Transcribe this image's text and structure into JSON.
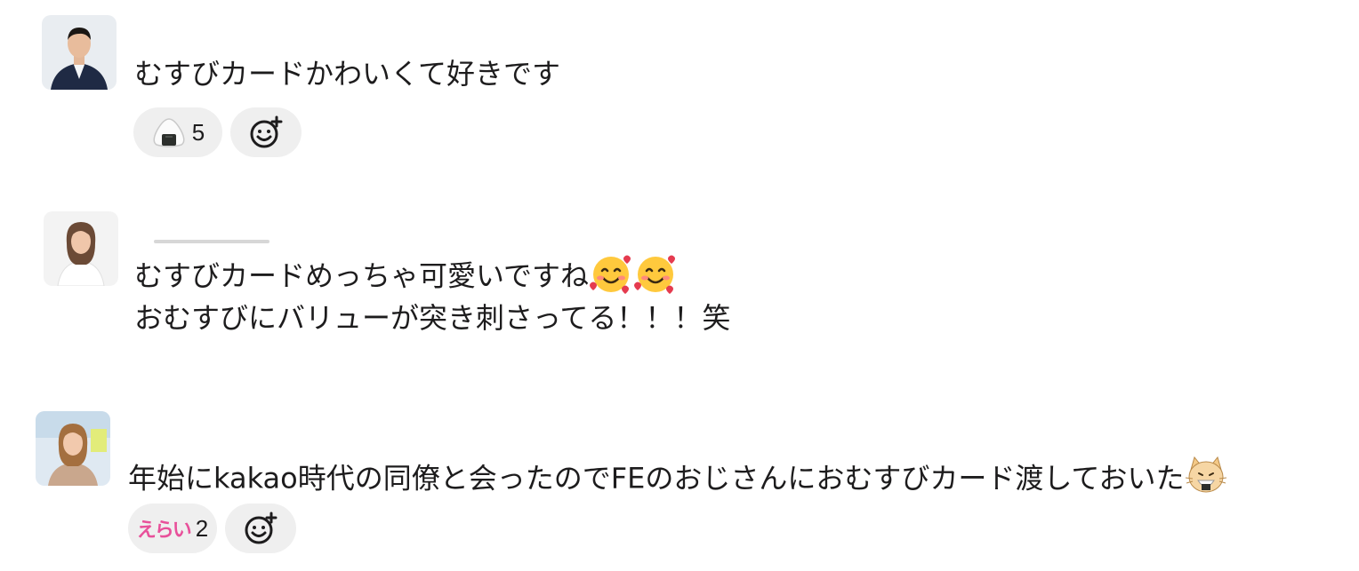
{
  "messages": [
    {
      "avatar": "avatar-man-navy-suit",
      "lines": [
        "むすびカードかわいくて好きです"
      ],
      "reactions": [
        {
          "emoji": "onigiri-icon",
          "count": "5"
        }
      ],
      "add_reaction": "add-reaction-icon"
    },
    {
      "avatar": "avatar-woman-white-blouse",
      "lines": [
        "むすびカードめっちゃ可愛いですね",
        "おむすびにバリューが突き刺さってる！！！笑"
      ],
      "inline_emojis": [
        "smiling-face-with-hearts-icon",
        "smiling-face-with-hearts-icon"
      ],
      "reactions": [],
      "add_reaction": ""
    },
    {
      "avatar": "avatar-woman-beige-top",
      "lines": [
        "年始にkakao時代の同僚と会ったのでFEのおじさんにおむすびカード渡しておいた"
      ],
      "inline_emojis": [
        "cat-eating-onigiri-icon"
      ],
      "reactions": [
        {
          "emoji": "erai-badge-icon",
          "emoji_text": "えらい",
          "count": "2"
        }
      ],
      "add_reaction": "add-reaction-icon"
    }
  ],
  "colors": {
    "text": "#1d1c1d",
    "reaction_bg": "#efefef",
    "erai_pink": "#e8509a",
    "heart_red": "#e53b4f",
    "face_yellow": "#ffc93d"
  }
}
